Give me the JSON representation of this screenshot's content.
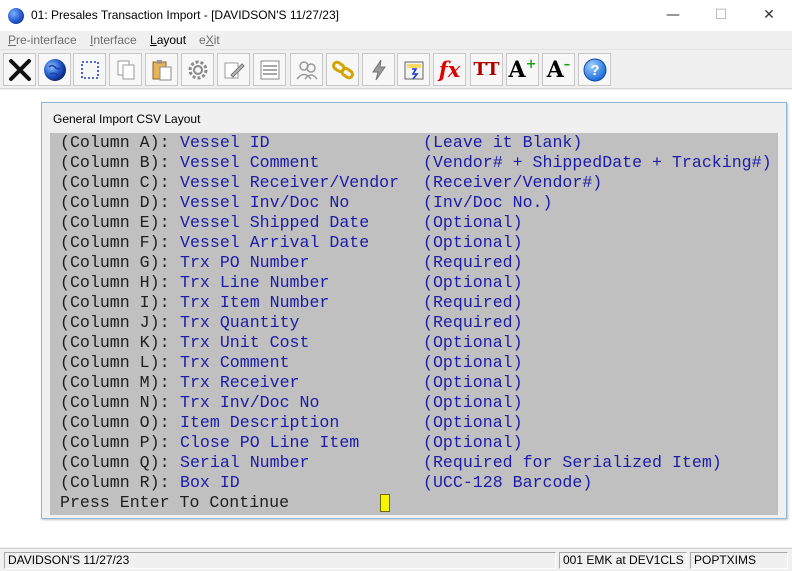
{
  "window": {
    "title": "01: Presales Transaction Import - [DAVIDSON'S 11/27/23]",
    "minimize_glyph": "—",
    "maximize_glyph": "☐",
    "close_glyph": "✕"
  },
  "menu": {
    "items": [
      {
        "hot": "P",
        "rest": "re-interface",
        "state": "disabled"
      },
      {
        "hot": "I",
        "rest": "nterface",
        "state": "disabled"
      },
      {
        "hot": "L",
        "rest": "ayout",
        "state": "active"
      },
      {
        "pre": "e",
        "hot": "X",
        "rest": "it",
        "state": "disabled"
      }
    ]
  },
  "toolbar": {
    "buttons": [
      {
        "icon": "close-x-icon"
      },
      {
        "icon": "globe-icon"
      },
      {
        "icon": "select-dotted-icon"
      },
      {
        "icon": "copy-icon"
      },
      {
        "icon": "paste-icon"
      },
      {
        "icon": "settings-gear-icon"
      },
      {
        "icon": "edit-pencil-icon"
      },
      {
        "icon": "list-icon"
      },
      {
        "icon": "users-icon"
      },
      {
        "icon": "chain-link-icon"
      },
      {
        "icon": "lightning-icon"
      },
      {
        "icon": "calculator-icon"
      },
      {
        "icon": "function-fx-icon",
        "label": "fx",
        "color": "#e00000"
      },
      {
        "icon": "font-size-icon",
        "label": "TT",
        "color": "#b00000"
      },
      {
        "icon": "font-increase-icon",
        "label": "A",
        "color": "#000000"
      },
      {
        "icon": "font-decrease-icon",
        "label": "A",
        "color": "#000000"
      },
      {
        "icon": "help-icon",
        "label": "?"
      }
    ]
  },
  "dialog": {
    "title": "General Import CSV Layout",
    "rows": [
      {
        "col": "(Column A):",
        "field": "Vessel ID",
        "note": "(Leave it Blank)"
      },
      {
        "col": "(Column B):",
        "field": "Vessel Comment",
        "note": "(Vendor# + ShippedDate + Tracking#)"
      },
      {
        "col": "(Column C):",
        "field": "Vessel Receiver/Vendor",
        "note": "(Receiver/Vendor#)"
      },
      {
        "col": "(Column D):",
        "field": "Vessel Inv/Doc No",
        "note": "(Inv/Doc No.)"
      },
      {
        "col": "(Column E):",
        "field": "Vessel Shipped Date",
        "note": "(Optional)"
      },
      {
        "col": "(Column F):",
        "field": "Vessel Arrival Date",
        "note": "(Optional)"
      },
      {
        "col": "(Column G):",
        "field": "Trx PO Number",
        "note": "(Required)"
      },
      {
        "col": "(Column H):",
        "field": "Trx Line Number",
        "note": "(Optional)"
      },
      {
        "col": "(Column I):",
        "field": "Trx Item Number",
        "note": "(Required)"
      },
      {
        "col": "(Column J):",
        "field": "Trx Quantity",
        "note": "(Required)"
      },
      {
        "col": "(Column K):",
        "field": "Trx Unit Cost",
        "note": "(Optional)"
      },
      {
        "col": "(Column L):",
        "field": "Trx Comment",
        "note": "(Optional)"
      },
      {
        "col": "(Column M):",
        "field": "Trx Receiver",
        "note": "(Optional)"
      },
      {
        "col": "(Column N):",
        "field": "Trx Inv/Doc No",
        "note": "(Optional)"
      },
      {
        "col": "(Column O):",
        "field": "Item Description",
        "note": "(Optional)"
      },
      {
        "col": "(Column P):",
        "field": "Close PO Line Item",
        "note": "(Optional)"
      },
      {
        "col": "(Column Q):",
        "field": "Serial Number",
        "note": "(Required for Serialized Item)"
      },
      {
        "col": "(Column R):",
        "field": "Box ID",
        "note": "(UCC-128 Barcode)"
      }
    ],
    "prompt": "Press Enter To Continue"
  },
  "status": {
    "company": "DAVIDSON'S 11/27/23",
    "user": "001 EMK at DEV1CLS",
    "program": "POPTXIMS"
  },
  "colors": {
    "terminal_bg": "#c0c0c0",
    "field_text": "#1c1ca8",
    "label_text": "#202020",
    "cursor": "#f5f500"
  }
}
